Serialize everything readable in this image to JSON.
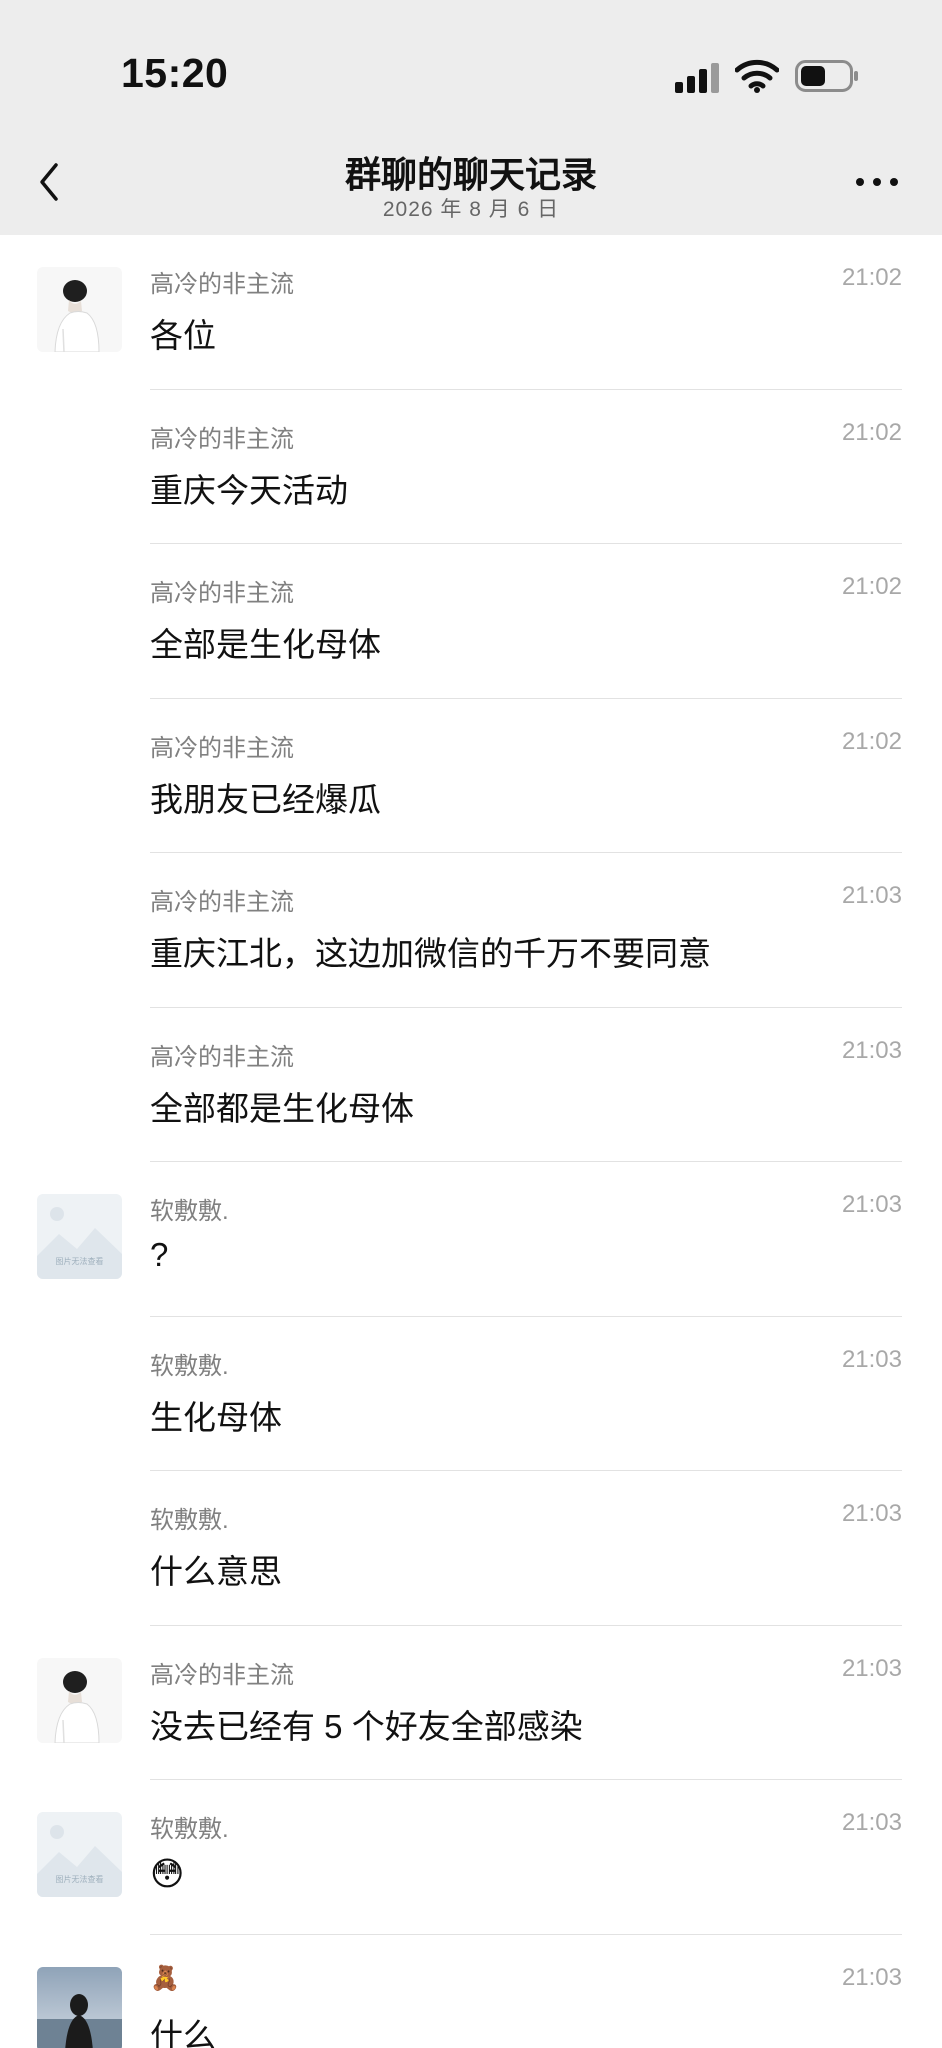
{
  "status_bar": {
    "time": "15:20"
  },
  "nav": {
    "title": "群聊的聊天记录",
    "subtitle": "2026 年 8 月 6 日"
  },
  "messages": [
    {
      "sender": "高冷的非主流",
      "time": "21:02",
      "text": "各位",
      "avatar": "boy-avatar"
    },
    {
      "sender": "高冷的非主流",
      "time": "21:02",
      "text": "重庆今天活动",
      "avatar": ""
    },
    {
      "sender": "高冷的非主流",
      "time": "21:02",
      "text": "全部是生化母体",
      "avatar": ""
    },
    {
      "sender": "高冷的非主流",
      "time": "21:02",
      "text": "我朋友已经爆瓜",
      "avatar": ""
    },
    {
      "sender": "高冷的非主流",
      "time": "21:03",
      "text": "重庆江北，这边加微信的千万不要同意",
      "avatar": ""
    },
    {
      "sender": "高冷的非主流",
      "time": "21:03",
      "text": "全部都是生化母体",
      "avatar": ""
    },
    {
      "sender": "软敷敷.",
      "time": "21:03",
      "text": "?",
      "avatar": "placeholder-avatar"
    },
    {
      "sender": "软敷敷.",
      "time": "21:03",
      "text": "生化母体",
      "avatar": ""
    },
    {
      "sender": "软敷敷.",
      "time": "21:03",
      "text": "什么意思",
      "avatar": ""
    },
    {
      "sender": "高冷的非主流",
      "time": "21:03",
      "text": "没去已经有 5 个好友全部感染",
      "avatar": "boy-avatar"
    },
    {
      "sender": "软敷敷.",
      "time": "21:03",
      "text": "😳",
      "avatar": "placeholder-avatar"
    },
    {
      "sender": "🧸",
      "time": "21:03",
      "text": "什么",
      "avatar": "photo-avatar"
    }
  ],
  "placeholder_avatar_text": "图片无法查看",
  "colors": {
    "header_bg": "#ededed",
    "sender": "#808080",
    "time": "#a8a8a8",
    "divider": "#e2e2e2"
  }
}
